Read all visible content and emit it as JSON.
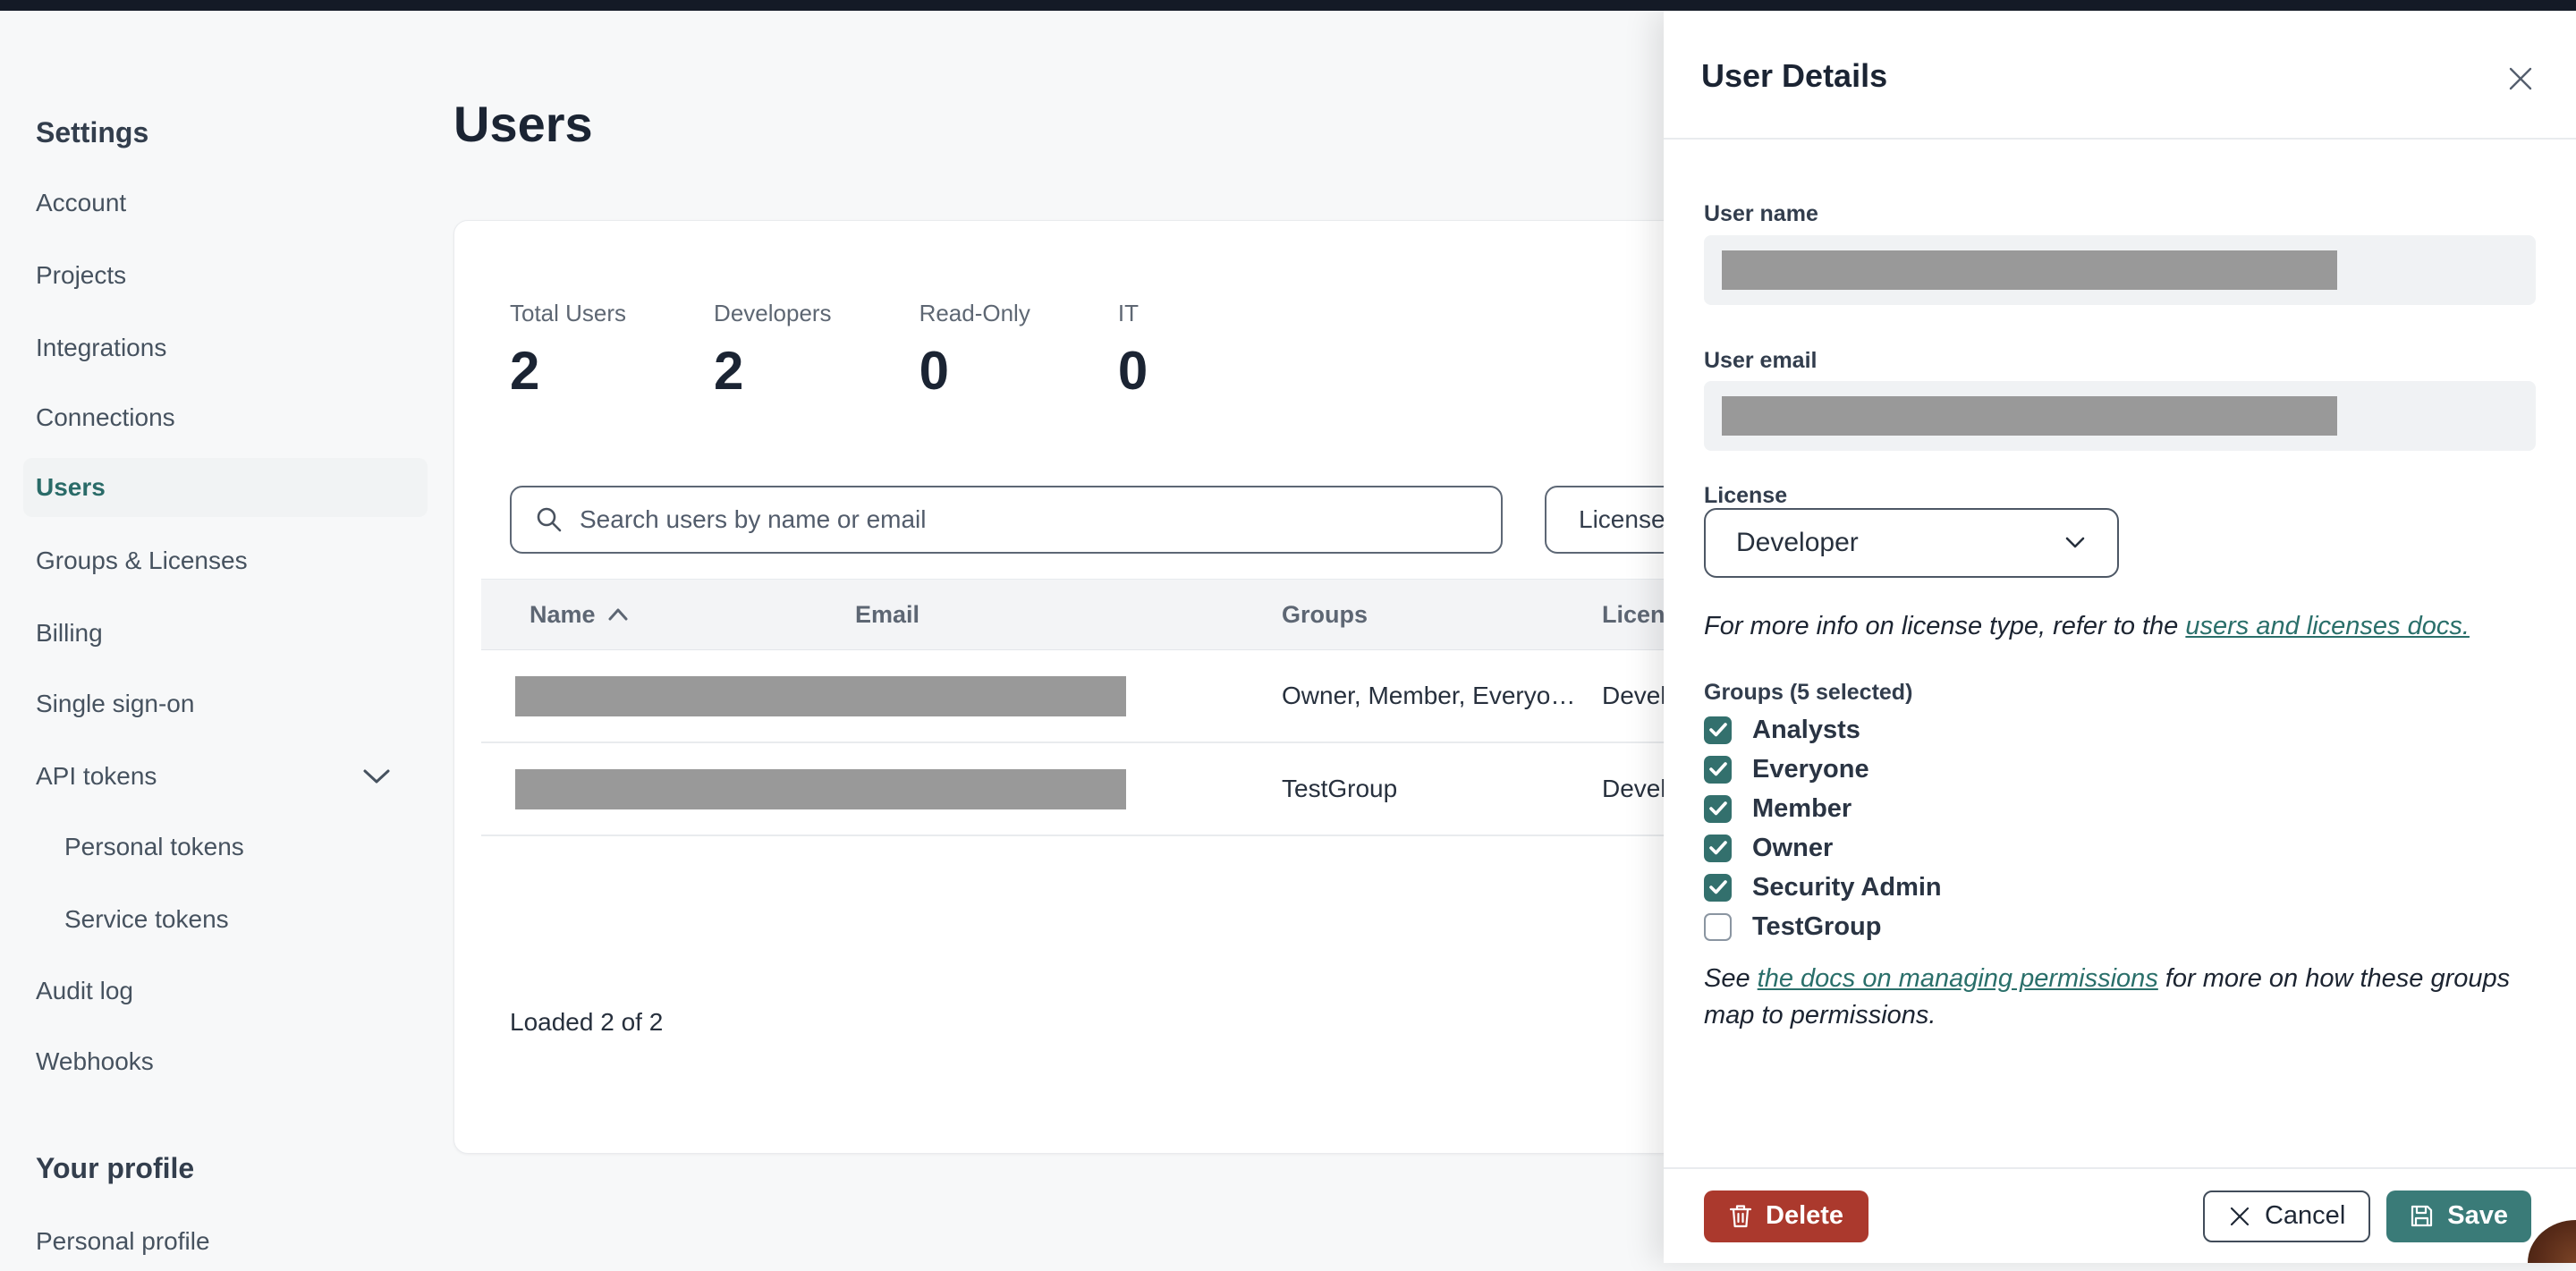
{
  "sidebar": {
    "heading": "Settings",
    "items": [
      {
        "label": "Account"
      },
      {
        "label": "Projects"
      },
      {
        "label": "Integrations"
      },
      {
        "label": "Connections"
      },
      {
        "label": "Users",
        "active": true
      },
      {
        "label": "Groups & Licenses"
      },
      {
        "label": "Billing"
      },
      {
        "label": "Single sign-on"
      },
      {
        "label": "API tokens",
        "expandable": true,
        "expanded": true
      },
      {
        "label": "Personal tokens",
        "child": true
      },
      {
        "label": "Service tokens",
        "child": true
      },
      {
        "label": "Audit log"
      },
      {
        "label": "Webhooks"
      }
    ],
    "profile_heading": "Your profile",
    "profile_items": [
      {
        "label": "Personal profile"
      }
    ]
  },
  "main": {
    "title": "Users",
    "stats": [
      {
        "label": "Total Users",
        "value": "2"
      },
      {
        "label": "Developers",
        "value": "2"
      },
      {
        "label": "Read-Only",
        "value": "0"
      },
      {
        "label": "IT",
        "value": "0"
      }
    ],
    "search_placeholder": "Search users by name or email",
    "license_filter_label": "License",
    "table": {
      "columns": [
        "Name",
        "Email",
        "Groups",
        "License"
      ],
      "sorted_column": "Name",
      "sort_direction": "asc",
      "rows": [
        {
          "name_redacted": true,
          "email_redacted": false,
          "groups": "Owner, Member, Everyo…",
          "license": "Developer"
        },
        {
          "name_redacted": true,
          "email_redacted": false,
          "groups": "TestGroup",
          "license": "Developer"
        }
      ]
    },
    "footer_status": "Loaded 2 of 2"
  },
  "drawer": {
    "title": "User Details",
    "user_name_label": "User name",
    "user_email_label": "User email",
    "license_label": "License",
    "license_value": "Developer",
    "license_note_prefix": "For more info on license type, refer to the ",
    "license_note_link": "users and licenses docs.",
    "groups_label": "Groups (5 selected)",
    "groups": [
      {
        "label": "Analysts",
        "checked": true
      },
      {
        "label": "Everyone",
        "checked": true
      },
      {
        "label": "Member",
        "checked": true
      },
      {
        "label": "Owner",
        "checked": true
      },
      {
        "label": "Security Admin",
        "checked": true
      },
      {
        "label": "TestGroup",
        "checked": false
      }
    ],
    "permissions_note_prefix": "See ",
    "permissions_note_link": "the docs on managing permissions",
    "permissions_note_suffix": " for more on how these groups map to permissions.",
    "buttons": {
      "delete": "Delete",
      "cancel": "Cancel",
      "save": "Save"
    }
  },
  "colors": {
    "accent_teal": "#2a6f6a",
    "checkbox_teal": "#33706d",
    "save_teal": "#3a7b78",
    "delete_red": "#ab392d",
    "redaction_gray": "#999999",
    "top_bar": "#141a26",
    "page_bg": "#f7f8f9"
  }
}
